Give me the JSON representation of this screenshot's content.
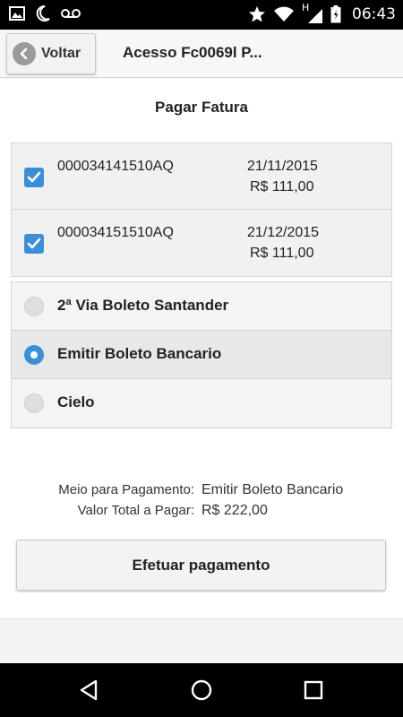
{
  "status_bar": {
    "time": "06:43",
    "left_icons": [
      "image-icon",
      "moon-icon",
      "voicemail-icon"
    ],
    "right_icons": [
      "star-icon",
      "wifi-icon",
      "signal-icon",
      "battery-icon"
    ],
    "network_letter": "H"
  },
  "header": {
    "back_label": "Voltar",
    "title": "Acesso Fc0069l P..."
  },
  "page": {
    "section_title": "Pagar Fatura"
  },
  "invoices": [
    {
      "code": "000034141510AQ",
      "date": "21/11/2015",
      "value": "R$ 111,00",
      "checked": true
    },
    {
      "code": "000034151510AQ",
      "date": "21/12/2015",
      "value": "R$ 111,00",
      "checked": true
    }
  ],
  "payment_methods": [
    {
      "label": "2ª Via Boleto Santander",
      "selected": false
    },
    {
      "label": "Emitir Boleto Bancario",
      "selected": true
    },
    {
      "label": "Cielo",
      "selected": false
    }
  ],
  "summary": {
    "method_label": "Meio para Pagamento:",
    "method_value": "Emitir Boleto Bancario",
    "total_label": "Valor Total a Pagar:",
    "total_value": "R$ 222,00"
  },
  "actions": {
    "submit_label": "Efetuar pagamento"
  },
  "colors": {
    "accent": "#3b8fd9",
    "status_bar": "#000000",
    "nav_bar": "#000000"
  }
}
